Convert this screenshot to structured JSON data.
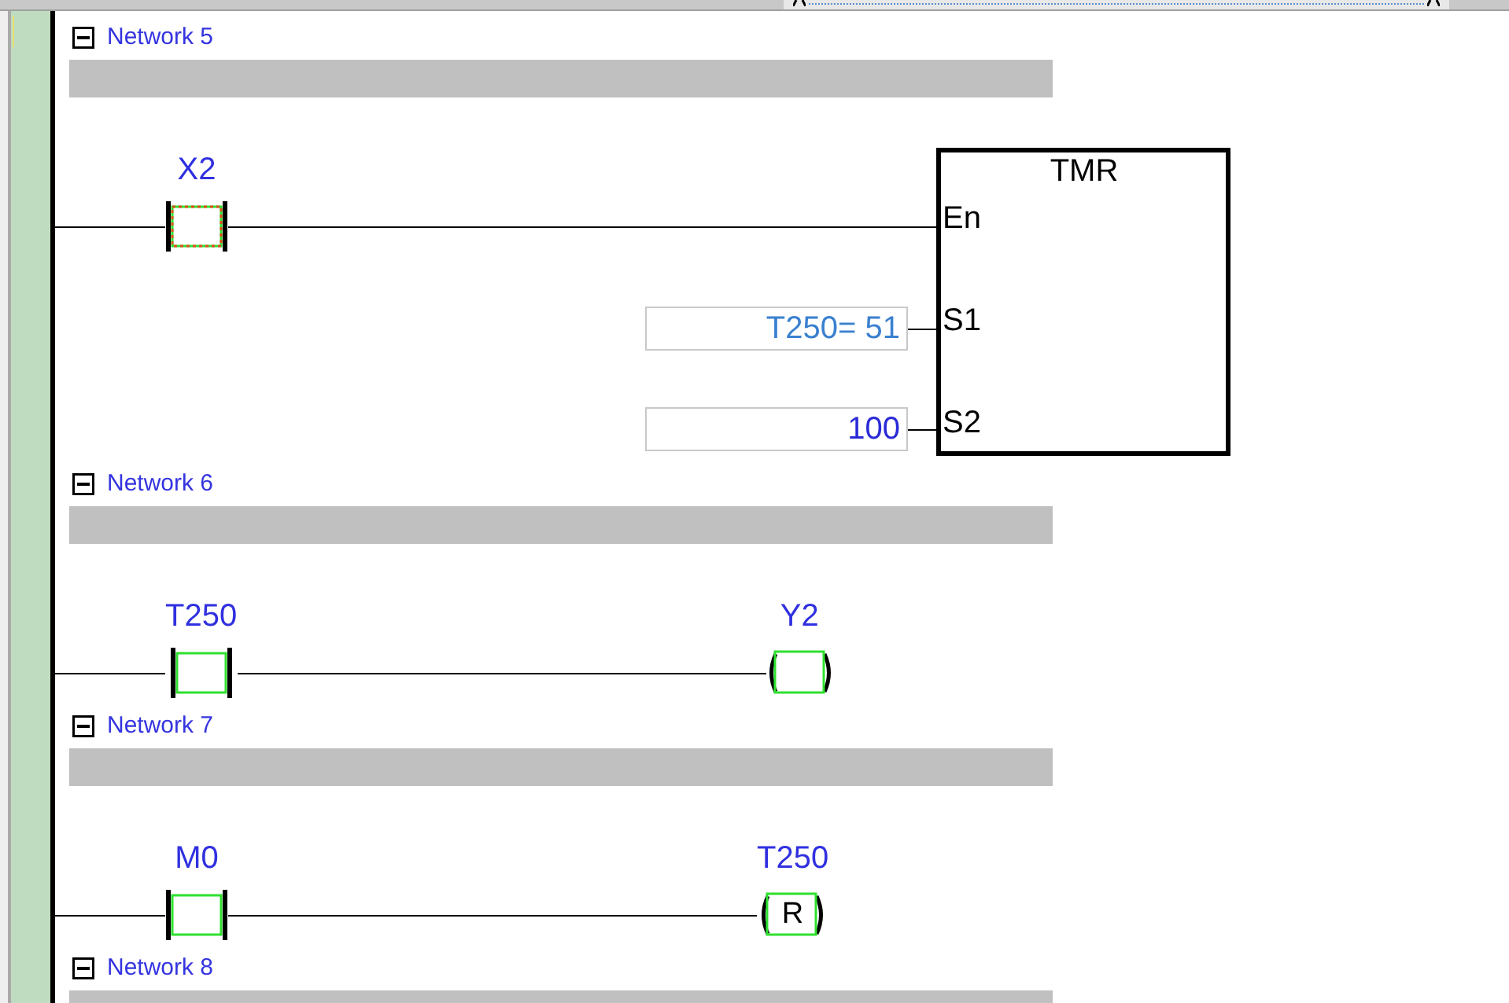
{
  "networks": [
    {
      "title": "Network 5",
      "expanded": true,
      "rung": {
        "elements": [
          {
            "kind": "contact",
            "label": "X2",
            "selected": true
          },
          {
            "kind": "function_block",
            "name": "TMR",
            "selected": false,
            "pins": [
              {
                "label": "En"
              },
              {
                "label": "S1",
                "operand": {
                  "kind": "monitored",
                  "text": "T250= 51"
                }
              },
              {
                "label": "S2",
                "operand": {
                  "kind": "constant",
                  "text": "100"
                }
              }
            ]
          }
        ]
      }
    },
    {
      "title": "Network 6",
      "expanded": true,
      "rung": {
        "elements": [
          {
            "kind": "contact",
            "label": "T250",
            "selected": false
          },
          {
            "kind": "coil",
            "label": "Y2",
            "selected": false
          }
        ]
      }
    },
    {
      "title": "Network 7",
      "expanded": true,
      "rung": {
        "elements": [
          {
            "kind": "contact",
            "label": "M0",
            "selected": false
          },
          {
            "kind": "reset_coil",
            "label": "T250",
            "text": "R",
            "selected": false
          }
        ]
      }
    },
    {
      "title": "Network 8",
      "expanded": true
    }
  ]
}
